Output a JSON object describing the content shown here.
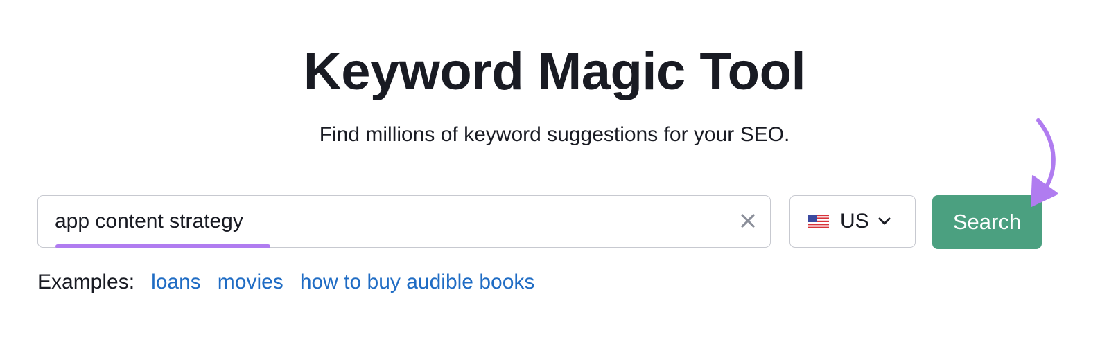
{
  "header": {
    "title": "Keyword Magic Tool",
    "subtitle": "Find millions of keyword suggestions for your SEO."
  },
  "search": {
    "value": "app content strategy",
    "clear_icon": "close-icon"
  },
  "country": {
    "flag_icon": "us-flag-icon",
    "selected": "US",
    "dropdown_icon": "chevron-down-icon"
  },
  "search_button": {
    "label": "Search",
    "color": "#4ba080"
  },
  "examples": {
    "label": "Examples:",
    "items": [
      "loans",
      "movies",
      "how to buy audible books"
    ],
    "link_color": "#1f6cc4"
  },
  "annotation": {
    "underline_color": "#b07cf0",
    "arrow_color": "#b07cf0"
  }
}
